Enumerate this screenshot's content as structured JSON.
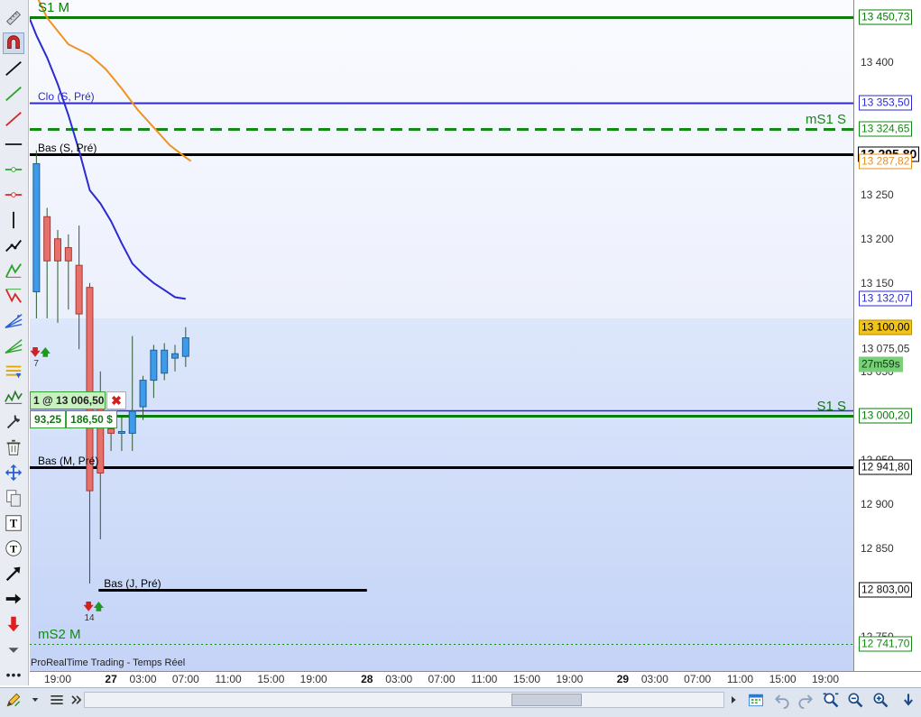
{
  "status": {
    "platform_label": "ProRealTime Trading - Temps Réel"
  },
  "countdown": "27m59s",
  "order": {
    "label": "1 @ 13 006,50",
    "points": "93,25",
    "cash": "186,50 $",
    "close_icon": "close-icon"
  },
  "levels": [
    {
      "id": "s1m",
      "text": "S1 M",
      "price": 13450.73,
      "price_label": "13 450,73",
      "color": "#0a7d0a",
      "style": "solid-thick",
      "text_align": "left",
      "text_size": 15
    },
    {
      "id": "clo-s-pre",
      "text": "Clo (S, Pré)",
      "price": 13353.5,
      "price_label": "13 353,50",
      "color": "#2b2bd1",
      "style": "solid",
      "text_align": "left",
      "text_size": 12
    },
    {
      "id": "ms1s",
      "text": "mS1 S",
      "price": 13324.65,
      "price_label": "13 324,65",
      "color": "#138a13",
      "style": "dashed",
      "text_align": "right",
      "text_size": 15
    },
    {
      "id": "bas-s-pre",
      "text": "Bas (S, Pré)",
      "price": 13295.8,
      "price_label": "13 295,80",
      "color": "#000000",
      "style": "solid-thick",
      "text_align": "left",
      "text_size": 12
    },
    {
      "id": "s1s",
      "text": "S1 S",
      "price": 13000.2,
      "price_label": "13 000,20",
      "color": "#0a7d0a",
      "style": "solid",
      "text_align": "right",
      "text_size": 15
    },
    {
      "id": "bas-m-pre",
      "text": "Bas (M, Pré)",
      "price": 12941.8,
      "price_label": "12 941,80",
      "color": "#000000",
      "style": "solid-thick",
      "text_align": "left",
      "text_size": 12
    },
    {
      "id": "bas-j-pre",
      "text": "Bas (J, Pré)",
      "price": 12803.0,
      "price_label": "12 803,00",
      "color": "#000000",
      "style": "solid-thick",
      "text_align": "segment",
      "text_size": 12
    },
    {
      "id": "ms2m",
      "text": "mS2 M",
      "price": 12741.7,
      "price_label": "12 741,70",
      "color": "#138a13",
      "style": "dotted",
      "text_align": "left",
      "text_size": 15
    }
  ],
  "price_badges": [
    {
      "price": 13295.8,
      "label": "13 295,80",
      "style": "current"
    },
    {
      "price": 13287.82,
      "label": "13 287,82",
      "style": "orange"
    },
    {
      "price": 13132.07,
      "label": "13 132,07",
      "style": "blue"
    },
    {
      "price": 13100.0,
      "label": "13 100,00",
      "style": "gold"
    },
    {
      "price": 13075.05,
      "label": "13 075,05",
      "style": "plain"
    }
  ],
  "arrow_markers": [
    {
      "x": "2024-01-26 17:00",
      "price": 13070,
      "count": "7"
    },
    {
      "x": "2024-01-26 22:00",
      "price": 12783,
      "count": "14"
    }
  ],
  "chart_data": {
    "type": "candlestick",
    "title": "",
    "xlabel": "",
    "ylabel": "",
    "interval": "1h",
    "ylim": [
      12730,
      13480
    ],
    "xlim": [
      "2024-01-26 16:20",
      "2024-01-29 22:10"
    ],
    "y_ticks": [
      {
        "value": 13400,
        "label": "13 400"
      },
      {
        "value": 13350,
        "label": "13 350"
      },
      {
        "value": 13300,
        "label": "13 300"
      },
      {
        "value": 13250,
        "label": "13 250"
      },
      {
        "value": 13200,
        "label": "13 200"
      },
      {
        "value": 13150,
        "label": "13 150"
      },
      {
        "value": 13050,
        "label": "13 050"
      },
      {
        "value": 12950,
        "label": "12 950"
      },
      {
        "value": 12900,
        "label": "12 900"
      },
      {
        "value": 12850,
        "label": "12 850"
      },
      {
        "value": 12750,
        "label": "12 750"
      }
    ],
    "x_ticks": [
      {
        "x": "2024-01-26 19:00",
        "label": "19:00",
        "day": false
      },
      {
        "x": "2024-01-27 00:00",
        "label": "27",
        "day": true
      },
      {
        "x": "2024-01-27 03:00",
        "label": "03:00",
        "day": false
      },
      {
        "x": "2024-01-27 07:00",
        "label": "07:00",
        "day": false
      },
      {
        "x": "2024-01-27 11:00",
        "label": "11:00",
        "day": false
      },
      {
        "x": "2024-01-27 15:00",
        "label": "15:00",
        "day": false
      },
      {
        "x": "2024-01-27 19:00",
        "label": "19:00",
        "day": false
      },
      {
        "x": "2024-01-28 00:00",
        "label": "28",
        "day": true
      },
      {
        "x": "2024-01-28 03:00",
        "label": "03:00",
        "day": false
      },
      {
        "x": "2024-01-28 07:00",
        "label": "07:00",
        "day": false
      },
      {
        "x": "2024-01-28 11:00",
        "label": "11:00",
        "day": false
      },
      {
        "x": "2024-01-28 15:00",
        "label": "15:00",
        "day": false
      },
      {
        "x": "2024-01-28 19:00",
        "label": "19:00",
        "day": false
      },
      {
        "x": "2024-01-29 00:00",
        "label": "29",
        "day": true
      },
      {
        "x": "2024-01-29 03:00",
        "label": "03:00",
        "day": false
      },
      {
        "x": "2024-01-29 07:00",
        "label": "07:00",
        "day": false
      },
      {
        "x": "2024-01-29 11:00",
        "label": "11:00",
        "day": false
      },
      {
        "x": "2024-01-29 15:00",
        "label": "15:00",
        "day": false
      },
      {
        "x": "2024-01-29 19:00",
        "label": "19:00",
        "day": false
      }
    ],
    "candles": [
      {
        "x": "2024-01-26 17:00",
        "o": 13140,
        "h": 13300,
        "l": 13110,
        "c": 13285
      },
      {
        "x": "2024-01-26 18:00",
        "o": 13225,
        "h": 13235,
        "l": 13110,
        "c": 13175
      },
      {
        "x": "2024-01-26 19:00",
        "o": 13200,
        "h": 13210,
        "l": 13105,
        "c": 13175
      },
      {
        "x": "2024-01-26 20:00",
        "o": 13190,
        "h": 13205,
        "l": 13120,
        "c": 13175
      },
      {
        "x": "2024-01-26 21:00",
        "o": 13170,
        "h": 13215,
        "l": 13075,
        "c": 13115
      },
      {
        "x": "2024-01-26 22:00",
        "o": 13145,
        "h": 13150,
        "l": 12810,
        "c": 12915
      },
      {
        "x": "2024-01-26 23:00",
        "o": 13010,
        "h": 13050,
        "l": 12860,
        "c": 12935
      },
      {
        "x": "2024-01-27 00:00",
        "o": 12985,
        "h": 13005,
        "l": 12960,
        "c": 12980
      },
      {
        "x": "2024-01-27 01:00",
        "o": 12980,
        "h": 13000,
        "l": 12960,
        "c": 12982
      },
      {
        "x": "2024-01-27 02:00",
        "o": 12980,
        "h": 13090,
        "l": 12960,
        "c": 13005
      },
      {
        "x": "2024-01-27 03:00",
        "o": 13010,
        "h": 13045,
        "l": 12995,
        "c": 13040
      },
      {
        "x": "2024-01-27 04:00",
        "o": 13040,
        "h": 13080,
        "l": 13020,
        "c": 13074
      },
      {
        "x": "2024-01-27 05:00",
        "o": 13048,
        "h": 13082,
        "l": 13040,
        "c": 13074
      },
      {
        "x": "2024-01-27 06:00",
        "o": 13065,
        "h": 13080,
        "l": 13050,
        "c": 13070
      },
      {
        "x": "2024-01-27 07:00",
        "o": 13067,
        "h": 13100,
        "l": 13055,
        "c": 13088
      }
    ],
    "series": [
      {
        "color": "#f0921e",
        "points": [
          {
            "x": "2024-01-26 16:20",
            "y": 13490
          },
          {
            "x": "2024-01-26 17:00",
            "y": 13475
          },
          {
            "x": "2024-01-26 18:00",
            "y": 13450
          },
          {
            "x": "2024-01-26 20:00",
            "y": 13420
          },
          {
            "x": "2024-01-26 22:00",
            "y": 13408
          },
          {
            "x": "2024-01-26 23:30",
            "y": 13392
          },
          {
            "x": "2024-01-27 01:00",
            "y": 13370
          },
          {
            "x": "2024-01-27 02:30",
            "y": 13346
          },
          {
            "x": "2024-01-27 04:00",
            "y": 13326
          },
          {
            "x": "2024-01-27 05:30",
            "y": 13306
          },
          {
            "x": "2024-01-27 07:00",
            "y": 13292
          },
          {
            "x": "2024-01-27 07:30",
            "y": 13287.82
          }
        ]
      },
      {
        "color": "#2b2bd1",
        "points": [
          {
            "x": "2024-01-26 16:20",
            "y": 13450
          },
          {
            "x": "2024-01-26 17:00",
            "y": 13430
          },
          {
            "x": "2024-01-26 18:00",
            "y": 13405
          },
          {
            "x": "2024-01-26 19:00",
            "y": 13375
          },
          {
            "x": "2024-01-26 20:00",
            "y": 13340
          },
          {
            "x": "2024-01-26 21:00",
            "y": 13300
          },
          {
            "x": "2024-01-26 22:00",
            "y": 13255
          },
          {
            "x": "2024-01-26 23:00",
            "y": 13240
          },
          {
            "x": "2024-01-27 00:00",
            "y": 13220
          },
          {
            "x": "2024-01-27 01:00",
            "y": 13195
          },
          {
            "x": "2024-01-27 02:00",
            "y": 13172
          },
          {
            "x": "2024-01-27 03:00",
            "y": 13160
          },
          {
            "x": "2024-01-27 04:00",
            "y": 13150
          },
          {
            "x": "2024-01-27 05:00",
            "y": 13142
          },
          {
            "x": "2024-01-27 06:00",
            "y": 13134
          },
          {
            "x": "2024-01-27 07:00",
            "y": 13132.07
          }
        ]
      }
    ]
  },
  "toolbar_icons": [
    "ruler-icon",
    "magnet-icon",
    "line-black-icon",
    "line-green-icon",
    "line-red-icon",
    "horizontal-line-icon",
    "green-marker-line-icon",
    "red-marker-line-icon",
    "vertical-line-icon",
    "polyline-icon",
    "fibonacci-green-icon",
    "fibonacci-red-icon",
    "fibonacci-fan-blue-icon",
    "fibonacci-fan-green-icon",
    "fibonacci-levels-icon",
    "zigzag-icon",
    "tools-icon",
    "trash-icon",
    "move-icon",
    "copy-icon",
    "text-icon",
    "text-circle-icon",
    "arrow-diagonal-icon",
    "arrow-right-icon",
    "arrow-down-red-icon",
    "chevron-down-icon"
  ],
  "bottombar_icons": [
    "pencil-icon",
    "dropdown-arrow-icon",
    "menu-icon",
    "double-chevron-icon",
    "scroll-right-icon",
    "calendar-icon",
    "undo-icon",
    "redo-icon",
    "zoom-fit-icon",
    "zoom-out-icon",
    "zoom-in-icon",
    "scroll-down-icon"
  ],
  "scroll": {
    "position": 0.75,
    "visible_fraction": 0.11
  }
}
